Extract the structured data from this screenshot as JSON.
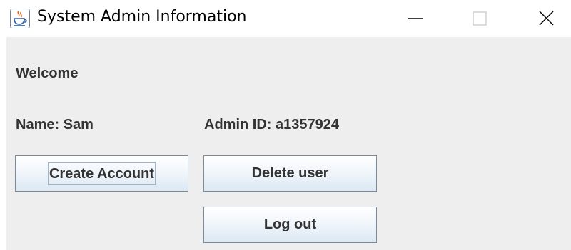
{
  "window": {
    "title": "System Admin Information",
    "icon": "java-coffee-cup-icon",
    "controls": {
      "minimize": "minimize-icon",
      "maximize": "maximize-icon",
      "close": "close-icon"
    }
  },
  "panel": {
    "welcome": "Welcome",
    "name_label": "Name: Sam",
    "admin_id_label": "Admin ID: a1357924"
  },
  "buttons": {
    "create_account": "Create Account",
    "delete_user": "Delete user",
    "log_out": "Log out"
  },
  "colors": {
    "panel_background": "#eeeeee",
    "button_border": "#7a8a99",
    "text": "#333333"
  }
}
